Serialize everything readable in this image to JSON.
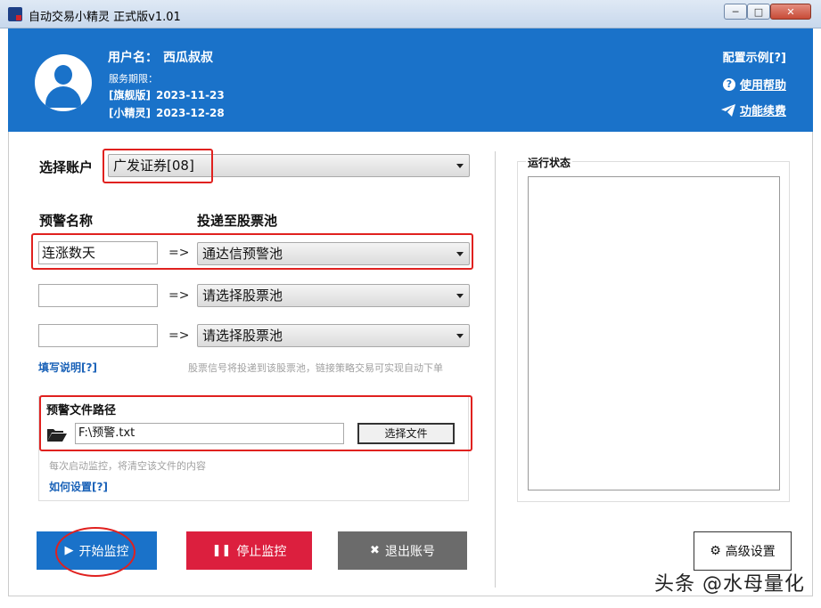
{
  "window": {
    "title": "自动交易小精灵 正式版v1.01",
    "min": "─",
    "max": "□",
    "close": "✕"
  },
  "header": {
    "username_label": "用户名：",
    "username": "西瓜叔叔",
    "service_label": "服务期限：",
    "services": [
      {
        "name": "[旗舰版]",
        "date": "2023-11-23"
      },
      {
        "name": "[小精灵]",
        "date": "2023-12-28"
      }
    ],
    "links": {
      "config_example": "配置示例[?]",
      "help": "使用帮助",
      "renew": "功能续费"
    }
  },
  "account": {
    "label": "选择账户",
    "selected": "广发证券[08]"
  },
  "alerts": {
    "name_header": "预警名称",
    "pool_header": "投递至股票池",
    "arrow": "=>",
    "rows": [
      {
        "name": "连涨数天",
        "pool": "通达信预警池"
      },
      {
        "name": "",
        "pool": "请选择股票池"
      },
      {
        "name": "",
        "pool": "请选择股票池"
      }
    ],
    "fill_help": "填写说明[?]",
    "hint": "股票信号将投递到该股票池，链接策略交易可实现自动下单"
  },
  "file": {
    "title": "预警文件路径",
    "path": "F:\\预警.txt",
    "choose_button": "选择文件",
    "clear_hint": "每次启动监控，将清空该文件的内容",
    "how_link": "如何设置[?]"
  },
  "status": {
    "title": "运行状态"
  },
  "buttons": {
    "start": "开始监控",
    "stop": "停止监控",
    "exit": "退出账号",
    "advanced": "高级设置"
  },
  "watermark": "头条 @水母量化",
  "colors": {
    "accent": "#1a72c9",
    "stop": "#dc1f3e",
    "exit": "#6b6b6b",
    "highlight": "#e0211f"
  }
}
